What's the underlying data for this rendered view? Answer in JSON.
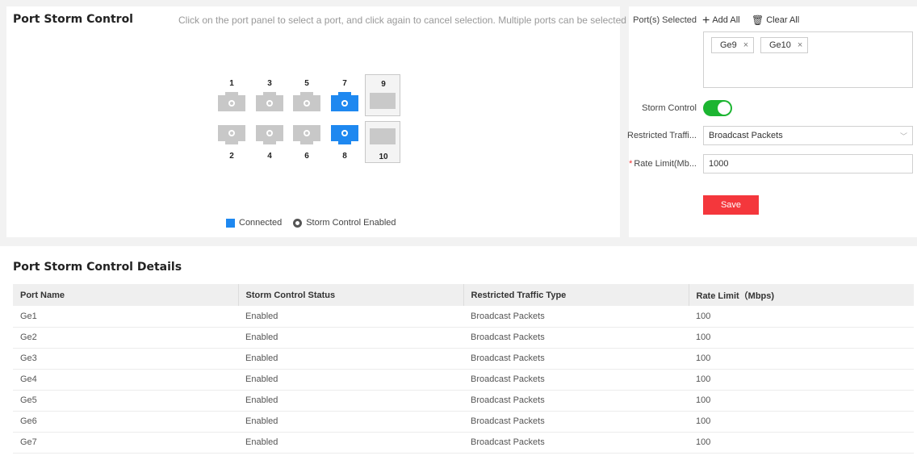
{
  "storm_panel": {
    "title": "Port Storm Control",
    "hint": "Click on the port panel to select a port, and click again to cancel selection. Multiple ports can be selected at a time.",
    "ports": [
      {
        "num": "1",
        "row": "top",
        "state": "off"
      },
      {
        "num": "3",
        "row": "top",
        "state": "off"
      },
      {
        "num": "5",
        "row": "top",
        "state": "off"
      },
      {
        "num": "7",
        "row": "top",
        "state": "connected"
      },
      {
        "num": "9",
        "row": "top",
        "state": "sfp"
      },
      {
        "num": "2",
        "row": "bottom",
        "state": "off"
      },
      {
        "num": "4",
        "row": "bottom",
        "state": "off"
      },
      {
        "num": "6",
        "row": "bottom",
        "state": "off"
      },
      {
        "num": "8",
        "row": "bottom",
        "state": "connected"
      },
      {
        "num": "10",
        "row": "bottom",
        "state": "sfp"
      }
    ],
    "legend": {
      "connected": "Connected",
      "storm_enabled": "Storm Control Enabled",
      "connected_color": "#1e88f0"
    }
  },
  "config_panel": {
    "ports_selected_label": "Port(s) Selected",
    "add_all": "Add All",
    "clear_all": "Clear All",
    "selected_tags": [
      "Ge9",
      "Ge10"
    ],
    "storm_control_label": "Storm Control",
    "storm_control_on": true,
    "restricted_label": "Restricted Traffi...",
    "restricted_value": "Broadcast Packets",
    "rate_label": "Rate Limit(Mb...",
    "rate_value": "1000",
    "save": "Save",
    "accent": "#1cb531",
    "save_color": "#f4373c"
  },
  "details": {
    "title": "Port Storm Control Details",
    "columns": [
      "Port Name",
      "Storm Control Status",
      "Restricted Traffic Type",
      "Rate Limit（Mbps)"
    ],
    "rows": [
      [
        "Ge1",
        "Enabled",
        "Broadcast Packets",
        "100"
      ],
      [
        "Ge2",
        "Enabled",
        "Broadcast Packets",
        "100"
      ],
      [
        "Ge3",
        "Enabled",
        "Broadcast Packets",
        "100"
      ],
      [
        "Ge4",
        "Enabled",
        "Broadcast Packets",
        "100"
      ],
      [
        "Ge5",
        "Enabled",
        "Broadcast Packets",
        "100"
      ],
      [
        "Ge6",
        "Enabled",
        "Broadcast Packets",
        "100"
      ],
      [
        "Ge7",
        "Enabled",
        "Broadcast Packets",
        "100"
      ]
    ]
  }
}
